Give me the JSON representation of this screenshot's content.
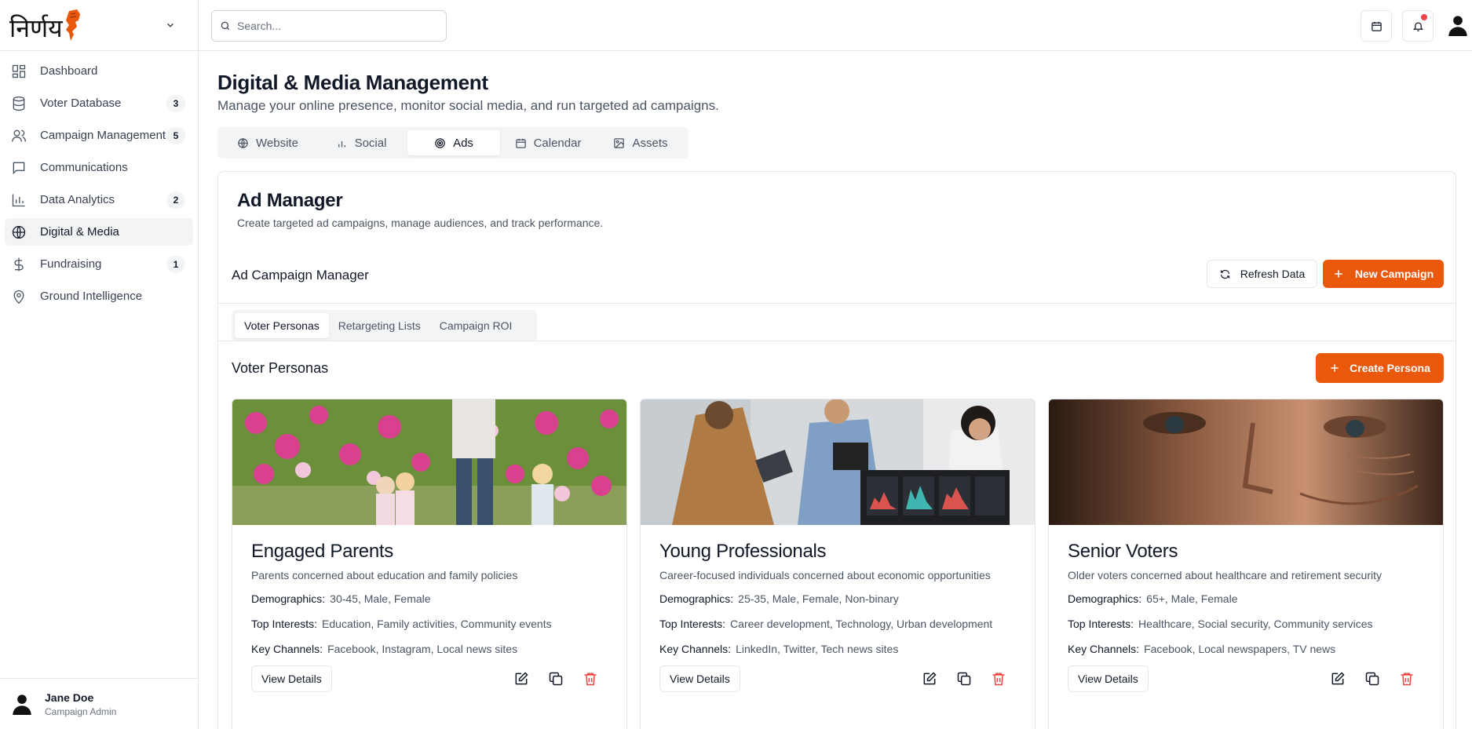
{
  "brand": {
    "name": "निर्णय"
  },
  "search": {
    "placeholder": "Search..."
  },
  "nav": [
    {
      "label": "Dashboard",
      "icon": "dashboard-icon",
      "badge": ""
    },
    {
      "label": "Voter Database",
      "icon": "database-icon",
      "badge": "3"
    },
    {
      "label": "Campaign Management",
      "icon": "users-icon",
      "badge": "5"
    },
    {
      "label": "Communications",
      "icon": "message-icon",
      "badge": ""
    },
    {
      "label": "Data Analytics",
      "icon": "bar-chart-icon",
      "badge": "2"
    },
    {
      "label": "Digital & Media",
      "icon": "globe-icon",
      "badge": "",
      "active": true
    },
    {
      "label": "Fundraising",
      "icon": "dollar-icon",
      "badge": "1"
    },
    {
      "label": "Ground Intelligence",
      "icon": "map-pin-icon",
      "badge": ""
    }
  ],
  "user": {
    "name": "Jane Doe",
    "role": "Campaign Admin"
  },
  "page": {
    "title": "Digital & Media Management",
    "subtitle": "Manage your online presence, monitor social media, and run targeted ad campaigns."
  },
  "tabs": [
    {
      "label": "Website",
      "icon": "globe-icon"
    },
    {
      "label": "Social",
      "icon": "bar-chart-icon"
    },
    {
      "label": "Ads",
      "icon": "target-icon",
      "active": true
    },
    {
      "label": "Calendar",
      "icon": "calendar-icon"
    },
    {
      "label": "Assets",
      "icon": "image-icon"
    }
  ],
  "ad_manager": {
    "title": "Ad Manager",
    "subtitle": "Create targeted ad campaigns, manage audiences, and track performance.",
    "section_title": "Ad Campaign Manager",
    "refresh_label": "Refresh Data",
    "new_campaign_label": "New Campaign",
    "subtabs": [
      "Voter Personas",
      "Retargeting Lists",
      "Campaign ROI"
    ],
    "personas_title": "Voter Personas",
    "create_persona_label": "Create Persona"
  },
  "labels": {
    "demographics": "Demographics:",
    "interests": "Top Interests:",
    "channels": "Key Channels:",
    "view_details": "View Details"
  },
  "personas": [
    {
      "name": "Engaged Parents",
      "description": "Parents concerned about education and family policies",
      "demographics": "30-45, Male, Female",
      "interests": "Education, Family activities, Community events",
      "channels": "Facebook, Instagram, Local news sites"
    },
    {
      "name": "Young Professionals",
      "description": "Career-focused individuals concerned about economic opportunities",
      "demographics": "25-35, Male, Female, Non-binary",
      "interests": "Career development, Technology, Urban development",
      "channels": "LinkedIn, Twitter, Tech news sites"
    },
    {
      "name": "Senior Voters",
      "description": "Older voters concerned about healthcare and retirement security",
      "demographics": "65+, Male, Female",
      "interests": "Healthcare, Social security, Community services",
      "channels": "Facebook, Local newspapers, TV news"
    }
  ],
  "colors": {
    "accent": "#ea580c",
    "danger": "#ef4444",
    "border": "#e5e7eb",
    "muted": "#4b5563"
  }
}
